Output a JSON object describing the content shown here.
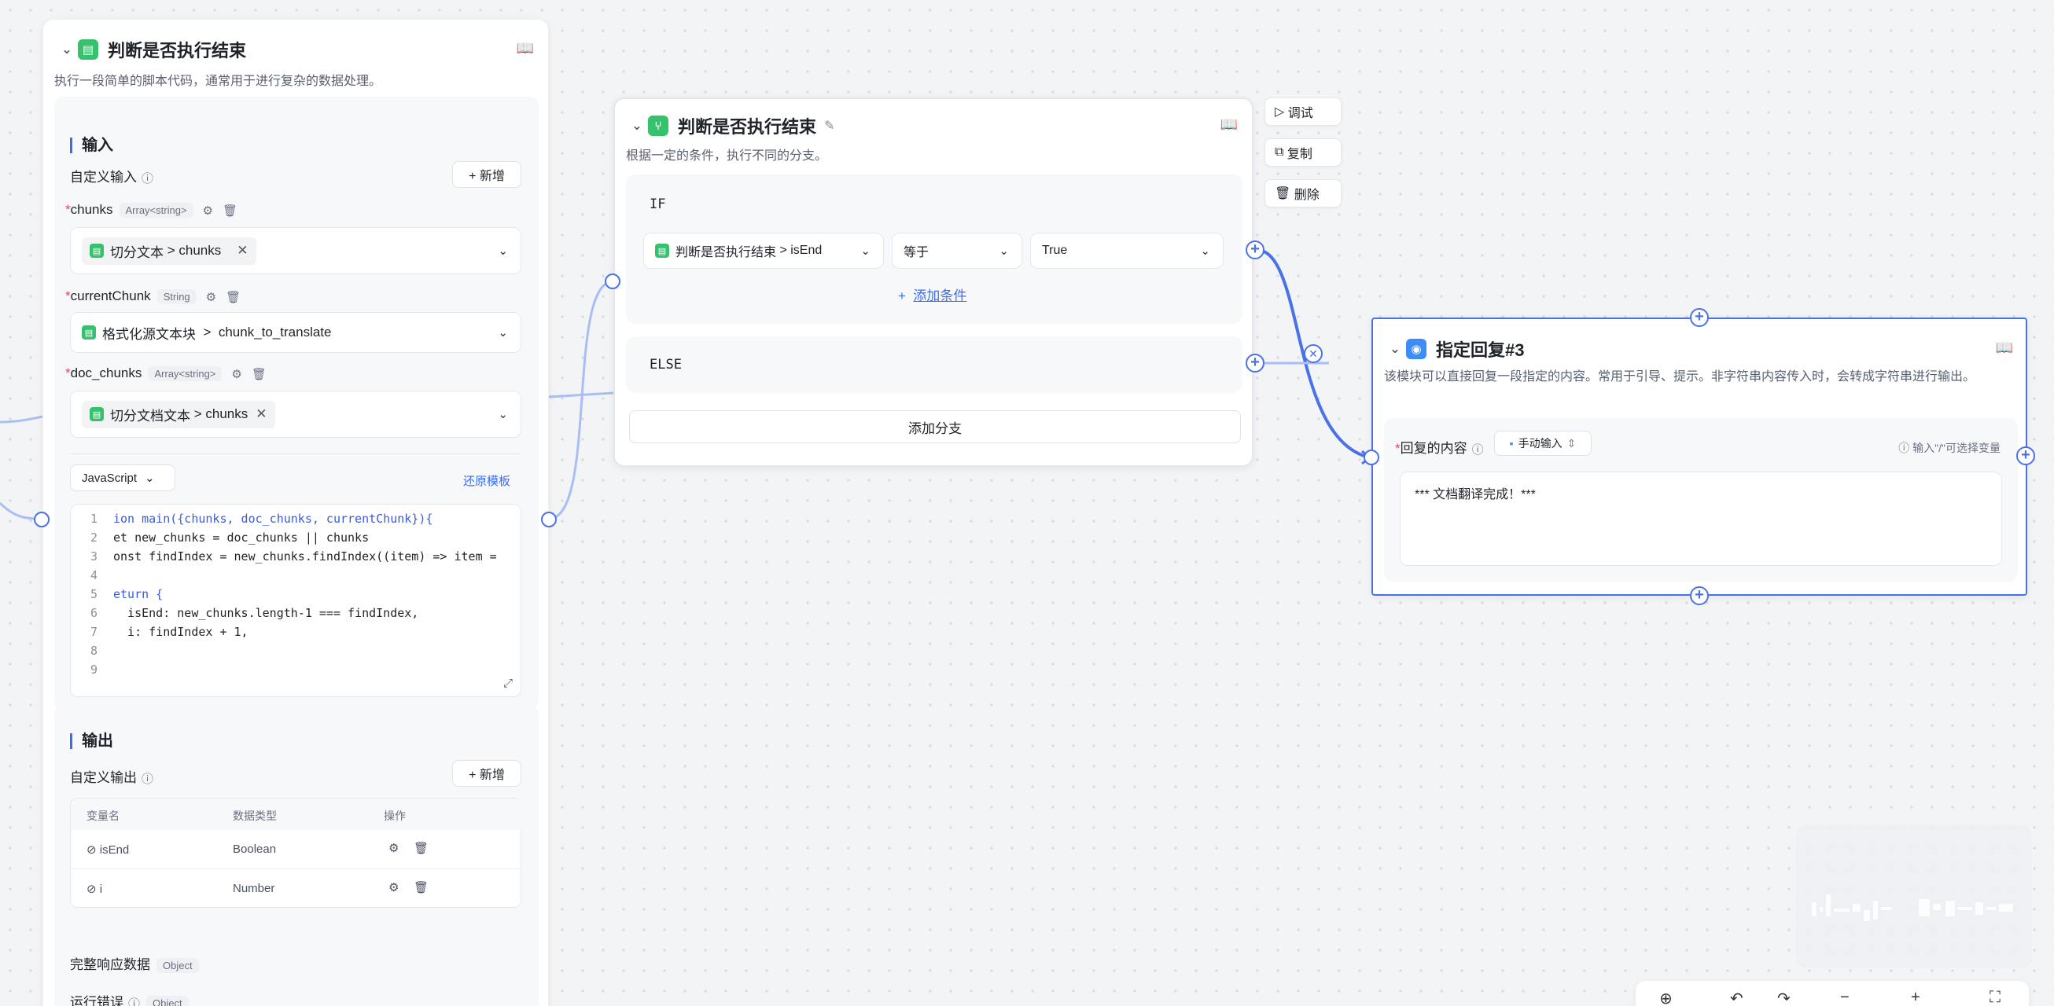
{
  "code_node": {
    "title": "判断是否执行结束",
    "desc": "执行一段简单的脚本代码，通常用于进行复杂的数据处理。",
    "input_title": "输入",
    "custom_input_label": "自定义输入",
    "add_label": "+ 新增",
    "inputs": [
      {
        "name": "chunks",
        "type": "Array<string>",
        "value_prefix": "切分文本",
        "value": "chunks"
      },
      {
        "name": "currentChunk",
        "type": "String",
        "value_prefix": "格式化源文本块",
        "value": "chunk_to_translate"
      },
      {
        "name": "doc_chunks",
        "type": "Array<string>",
        "value_prefix": "切分文档文本",
        "value": "chunks"
      }
    ],
    "language": "JavaScript",
    "restore_template": "还原模板",
    "code_lines": [
      "ion main({chunks, doc_chunks, currentChunk}){",
      "et new_chunks = doc_chunks || chunks",
      "onst findIndex = new_chunks.findIndex((item) => item =",
      "",
      "eturn {",
      "  isEnd: new_chunks.length-1 === findIndex,",
      "  i: findIndex + 1,",
      "",
      ""
    ],
    "output_title": "输出",
    "custom_output_label": "自定义输出",
    "columns": [
      "变量名",
      "数据类型",
      "操作"
    ],
    "outputs": [
      {
        "name": "isEnd",
        "type": "Boolean"
      },
      {
        "name": "i",
        "type": "Number"
      }
    ],
    "response_label": "完整响应数据",
    "response_type": "Object",
    "error_label": "运行错误",
    "error_type": "Object"
  },
  "if_node": {
    "title": "判断是否执行结束",
    "desc": "根据一定的条件，执行不同的分支。",
    "if_label": "IF",
    "var_prefix": "判断是否执行结束",
    "var_name": "isEnd",
    "operator": "等于",
    "value": "True",
    "add_condition": "添加条件",
    "else_label": "ELSE",
    "add_branch": "添加分支",
    "actions": [
      "调试",
      "复制",
      "删除"
    ]
  },
  "reply_node": {
    "title": "指定回复#3",
    "desc": "该模块可以直接回复一段指定的内容。常用于引导、提示。非字符串内容传入时，会转成字符串进行输出。",
    "content_label": "回复的内容",
    "mode": "手动输入",
    "hint": "输入\"/\"可选择变量",
    "content": "*** 文档翻译完成！***"
  },
  "colors": {
    "accent": "#3d6cf0",
    "green": "#36c26c",
    "port": "#4a72e8"
  }
}
